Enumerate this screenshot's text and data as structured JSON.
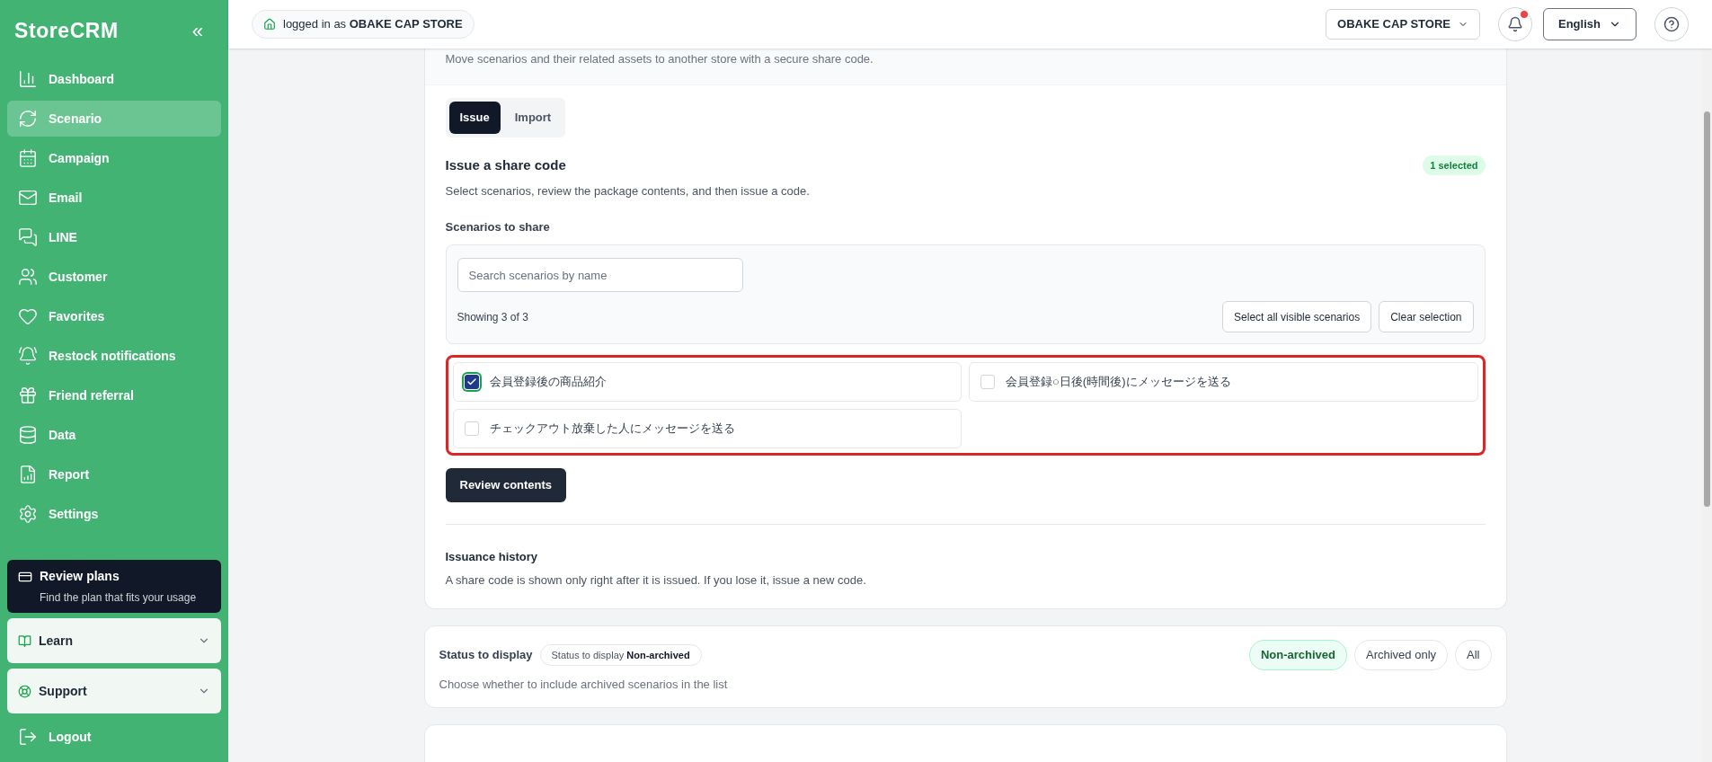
{
  "sidebar": {
    "logo": "StoreCRM",
    "collapse": "«",
    "items": [
      {
        "label": "Dashboard",
        "selected": false
      },
      {
        "label": "Scenario",
        "selected": true
      },
      {
        "label": "Campaign",
        "selected": false
      },
      {
        "label": "Email",
        "selected": false
      },
      {
        "label": "LINE",
        "selected": false
      },
      {
        "label": "Customer",
        "selected": false
      },
      {
        "label": "Favorites",
        "selected": false
      },
      {
        "label": "Restock notifications",
        "selected": false
      },
      {
        "label": "Friend referral",
        "selected": false
      },
      {
        "label": "Data",
        "selected": false
      },
      {
        "label": "Report",
        "selected": false
      },
      {
        "label": "Settings",
        "selected": false
      }
    ],
    "plan": {
      "title": "Review plans",
      "subtitle": "Find the plan that fits your usage"
    },
    "sections": [
      {
        "label": "Learn",
        "expanded": false
      },
      {
        "label": "Support",
        "expanded": false
      }
    ],
    "logout": "Logout"
  },
  "topbar": {
    "login_prefix": "logged in as",
    "store": "OBAKE CAP STORE",
    "store_menu": "OBAKE CAP STORE",
    "notification_dot": true,
    "language": "English"
  },
  "share": {
    "subtitle": "Move scenarios and their related assets to another store with a secure share code.",
    "tabs": [
      {
        "label": "Issue",
        "selected": true
      },
      {
        "label": "Import",
        "selected": false
      }
    ],
    "title": "Issue a share code",
    "badge": "1 selected",
    "description": "Select scenarios, review the package contents, and then issue a code.",
    "scenarios_label": "Scenarios to share",
    "search": {
      "placeholder": "Search scenarios by name"
    },
    "showing": "Showing 3 of 3",
    "buttons": [
      "Select all visible scenarios",
      "Clear selection"
    ],
    "scenarios": [
      {
        "name": "会員登録後の商品紹介",
        "checked": true
      },
      {
        "name": "会員登録○日後(時間後)にメッセージを送る",
        "checked": false
      },
      {
        "name": "チェックアウト放棄した人にメッセージを送る",
        "checked": false
      }
    ],
    "review_button": "Review contents",
    "history_title": "Issuance history",
    "history_text": "A share code is shown only right after it is issued. If you lose it, issue a new code."
  },
  "status": {
    "title": "Status to display",
    "chip_label": "Status to display",
    "chip_value": "Non-archived",
    "options": [
      {
        "label": "Non-archived",
        "selected": true
      },
      {
        "label": "Archived only",
        "selected": false
      },
      {
        "label": "All",
        "selected": false
      }
    ],
    "hint": "Choose whether to include archived scenarios in the list"
  }
}
